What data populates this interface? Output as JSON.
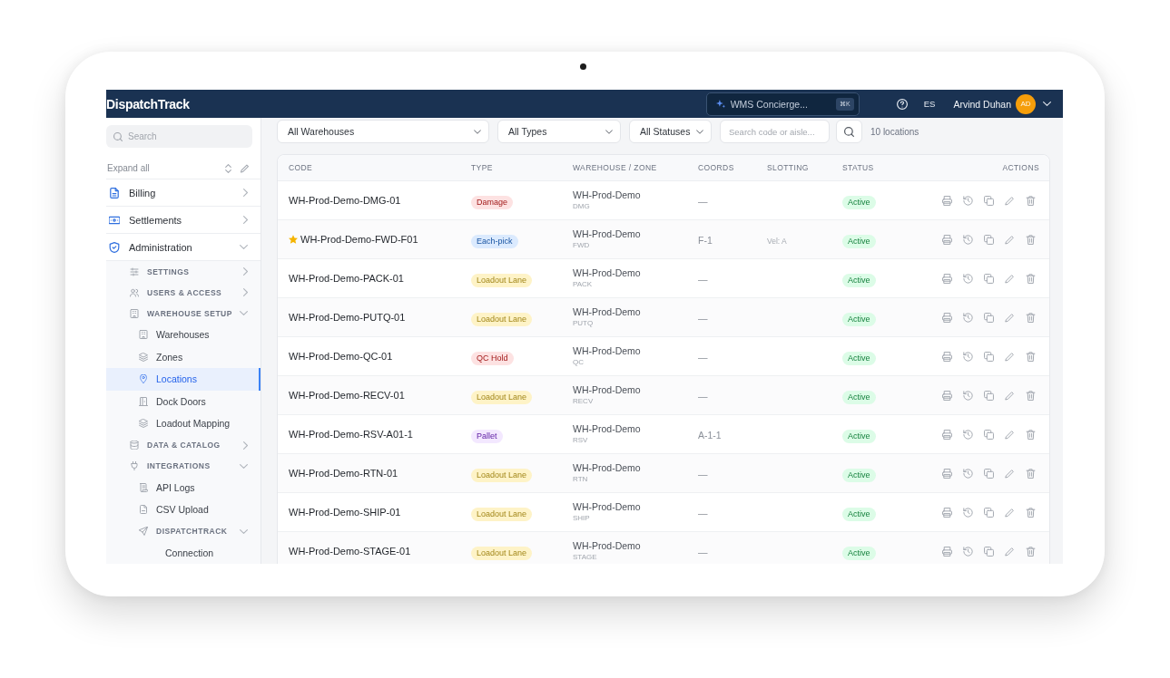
{
  "topbar": {
    "logo": "DispatchTrack",
    "assistant": {
      "label": "WMS Concierge...",
      "shortcut": "⌘K"
    },
    "language": "ES",
    "user": {
      "name": "Arvind Duhan",
      "initials": "AD"
    }
  },
  "sidebar": {
    "search": {
      "placeholder": "Search"
    },
    "expand_all": "Expand all",
    "items": [
      {
        "label": "Billing",
        "expanded": false,
        "selected": false
      },
      {
        "label": "Settlements",
        "expanded": false,
        "selected": false
      },
      {
        "label": "Administration",
        "expanded": true,
        "selected": false,
        "children": [
          {
            "label": "SETTINGS",
            "expanded": false,
            "selected": false
          },
          {
            "label": "USERS & ACCESS",
            "expanded": false,
            "selected": false
          },
          {
            "label": "WAREHOUSE SETUP",
            "expanded": true,
            "selected": false,
            "children": [
              {
                "label": "Warehouses",
                "selected": false
              },
              {
                "label": "Zones",
                "selected": false
              },
              {
                "label": "Locations",
                "selected": true
              },
              {
                "label": "Dock Doors",
                "selected": false
              },
              {
                "label": "Loadout Mapping",
                "selected": false
              }
            ]
          },
          {
            "label": "DATA & CATALOG",
            "expanded": false,
            "selected": false
          },
          {
            "label": "INTEGRATIONS",
            "expanded": true,
            "selected": false,
            "children": [
              {
                "label": "API Logs",
                "selected": false
              },
              {
                "label": "CSV Upload",
                "selected": false
              },
              {
                "label": "DISPATCHTRACK",
                "expanded": true,
                "selected": false,
                "children": [
                  {
                    "label": "Connection",
                    "selected": false
                  }
                ]
              }
            ]
          }
        ]
      }
    ]
  },
  "filters": {
    "selects": [
      {
        "value": "All Warehouses"
      },
      {
        "value": "All Types"
      },
      {
        "value": "All Statuses"
      }
    ],
    "search": {
      "placeholder": "Search code or aisle..."
    },
    "count": "10 locations"
  },
  "table": {
    "columns": [
      "CODE",
      "TYPE",
      "WAREHOUSE / ZONE",
      "COORDS",
      "SLOTTING",
      "STATUS",
      "ACTIONS"
    ],
    "rows": [
      {
        "code": "WH-Prod-Demo-DMG-01",
        "starred": false,
        "type": {
          "label": "Damage",
          "color": "#fde2e2"
        },
        "warehouse": "WH-Prod-Demo",
        "zone": "DMG",
        "coords": "—",
        "status": "Active"
      },
      {
        "code": "WH-Prod-Demo-FWD-F01",
        "starred": true,
        "type": {
          "label": "Each-pick",
          "color": "#dbeafe"
        },
        "warehouse": "WH-Prod-Demo",
        "zone": "FWD",
        "coords": "F-1",
        "slotting": "Vel: A",
        "status": "Active"
      },
      {
        "code": "WH-Prod-Demo-PACK-01",
        "starred": false,
        "type": {
          "label": "Loadout Lane",
          "color": "#fef3c7"
        },
        "warehouse": "WH-Prod-Demo",
        "zone": "PACK",
        "coords": "—",
        "status": "Active"
      },
      {
        "code": "WH-Prod-Demo-PUTQ-01",
        "starred": false,
        "type": {
          "label": "Loadout Lane",
          "color": "#fef3c7"
        },
        "warehouse": "WH-Prod-Demo",
        "zone": "PUTQ",
        "coords": "—",
        "status": "Active"
      },
      {
        "code": "WH-Prod-Demo-QC-01",
        "starred": false,
        "type": {
          "label": "QC Hold",
          "color": "#fde2e2"
        },
        "warehouse": "WH-Prod-Demo",
        "zone": "QC",
        "coords": "—",
        "status": "Active"
      },
      {
        "code": "WH-Prod-Demo-RECV-01",
        "starred": false,
        "type": {
          "label": "Loadout Lane",
          "color": "#fef3c7"
        },
        "warehouse": "WH-Prod-Demo",
        "zone": "RECV",
        "coords": "—",
        "status": "Active"
      },
      {
        "code": "WH-Prod-Demo-RSV-A01-1",
        "starred": false,
        "type": {
          "label": "Pallet",
          "color": "#f3e8ff"
        },
        "warehouse": "WH-Prod-Demo",
        "zone": "RSV",
        "coords": "A-1-1",
        "status": "Active"
      },
      {
        "code": "WH-Prod-Demo-RTN-01",
        "starred": false,
        "type": {
          "label": "Loadout Lane",
          "color": "#fef3c7"
        },
        "warehouse": "WH-Prod-Demo",
        "zone": "RTN",
        "coords": "—",
        "status": "Active"
      },
      {
        "code": "WH-Prod-Demo-SHIP-01",
        "starred": false,
        "type": {
          "label": "Loadout Lane",
          "color": "#fef3c7"
        },
        "warehouse": "WH-Prod-Demo",
        "zone": "SHIP",
        "coords": "—",
        "status": "Active"
      },
      {
        "code": "WH-Prod-Demo-STAGE-01",
        "starred": false,
        "type": {
          "label": "Loadout Lane",
          "color": "#fef3c7"
        },
        "warehouse": "WH-Prod-Demo",
        "zone": "STAGE",
        "coords": "—",
        "status": "Active"
      }
    ]
  }
}
